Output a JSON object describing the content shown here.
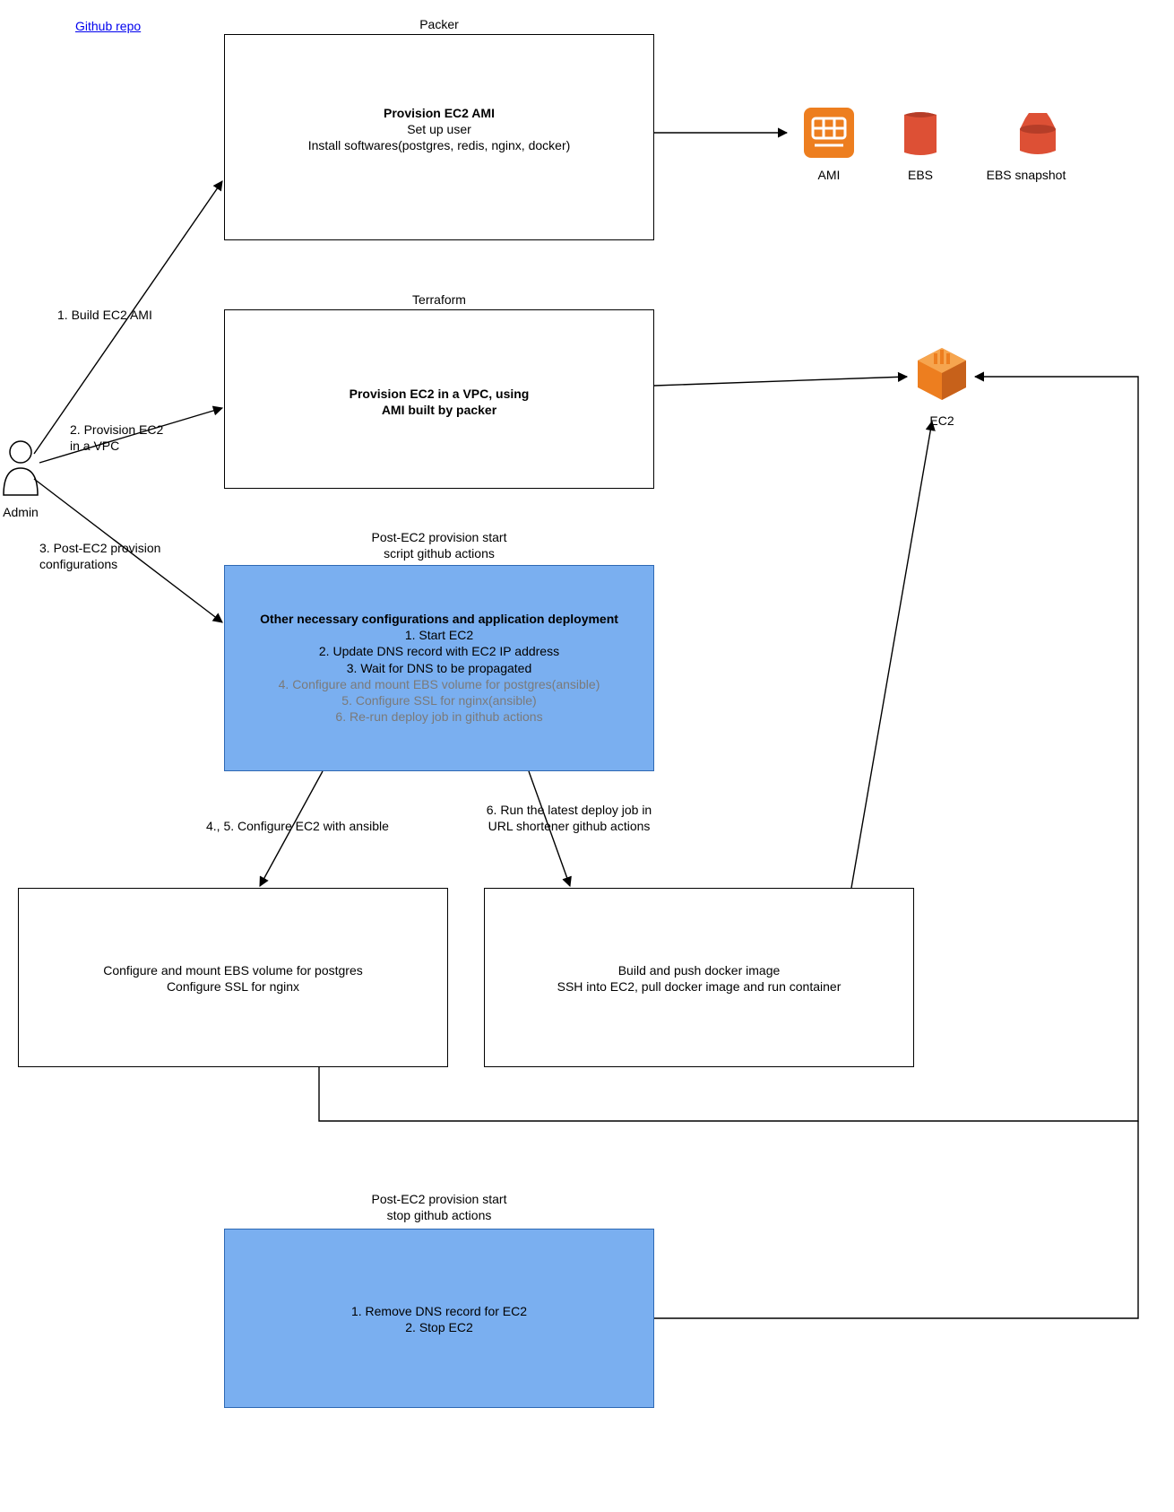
{
  "link": {
    "text": "Github repo"
  },
  "admin": {
    "label": "Admin"
  },
  "packer": {
    "header": "Packer",
    "title": "Provision EC2 AMI",
    "line1": "Set up user",
    "line2": "Install softwares(postgres, redis, nginx, docker)"
  },
  "terraform": {
    "header": "Terraform",
    "title_l1": "Provision EC2 in a VPC, using",
    "title_l2": "AMI built by packer"
  },
  "start": {
    "header_l1": "Post-EC2 provision start",
    "header_l2": "script github actions",
    "title": "Other necessary configurations and application deployment",
    "s1": "1. Start EC2",
    "s2": "2. Update DNS record with EC2 IP address",
    "s3": "3. Wait for DNS to be propagated",
    "s4": "4. Configure and mount EBS volume for postgres(ansible)",
    "s5": "5. Configure SSL for nginx(ansible)",
    "s6": "6. Re-run deploy job in github actions"
  },
  "ansible": {
    "l1": "Configure and mount EBS volume for postgres",
    "l2": "Configure SSL for nginx"
  },
  "deploy": {
    "l1": "Build and push docker image",
    "l2": "SSH into EC2, pull docker image and run container"
  },
  "stop": {
    "header_l1": "Post-EC2 provision start",
    "header_l2": "stop github actions",
    "l1": "1. Remove DNS record for EC2",
    "l2": "2. Stop EC2"
  },
  "edges": {
    "e1": "1. Build EC2 AMI",
    "e2_l1": "2. Provision EC2",
    "e2_l2": "in a VPC",
    "e3_l1": "3. Post-EC2 provision",
    "e3_l2": "configurations",
    "e45": "4., 5. Configure EC2 with ansible",
    "e6_l1": "6. Run the latest deploy job in",
    "e6_l2": "URL shortener github actions"
  },
  "icons": {
    "ami": "AMI",
    "ebs": "EBS",
    "ebs_snap": "EBS snapshot",
    "ec2": "EC2"
  }
}
